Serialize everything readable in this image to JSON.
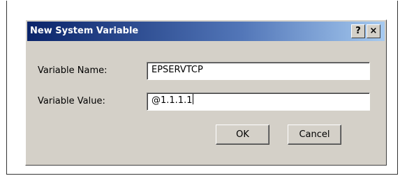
{
  "dialog": {
    "title": "New System Variable",
    "help_button": "?",
    "close_button": "×"
  },
  "fields": {
    "name_label": "Variable Name:",
    "name_value": "EPSERVTCP",
    "value_label": "Variable Value:",
    "value_value": "@1.1.1.1"
  },
  "buttons": {
    "ok": "OK",
    "cancel": "Cancel"
  },
  "colors": {
    "titlebar_start": "#0a246a",
    "titlebar_end": "#a6caf0",
    "dialog_face": "#d4d0c8"
  }
}
